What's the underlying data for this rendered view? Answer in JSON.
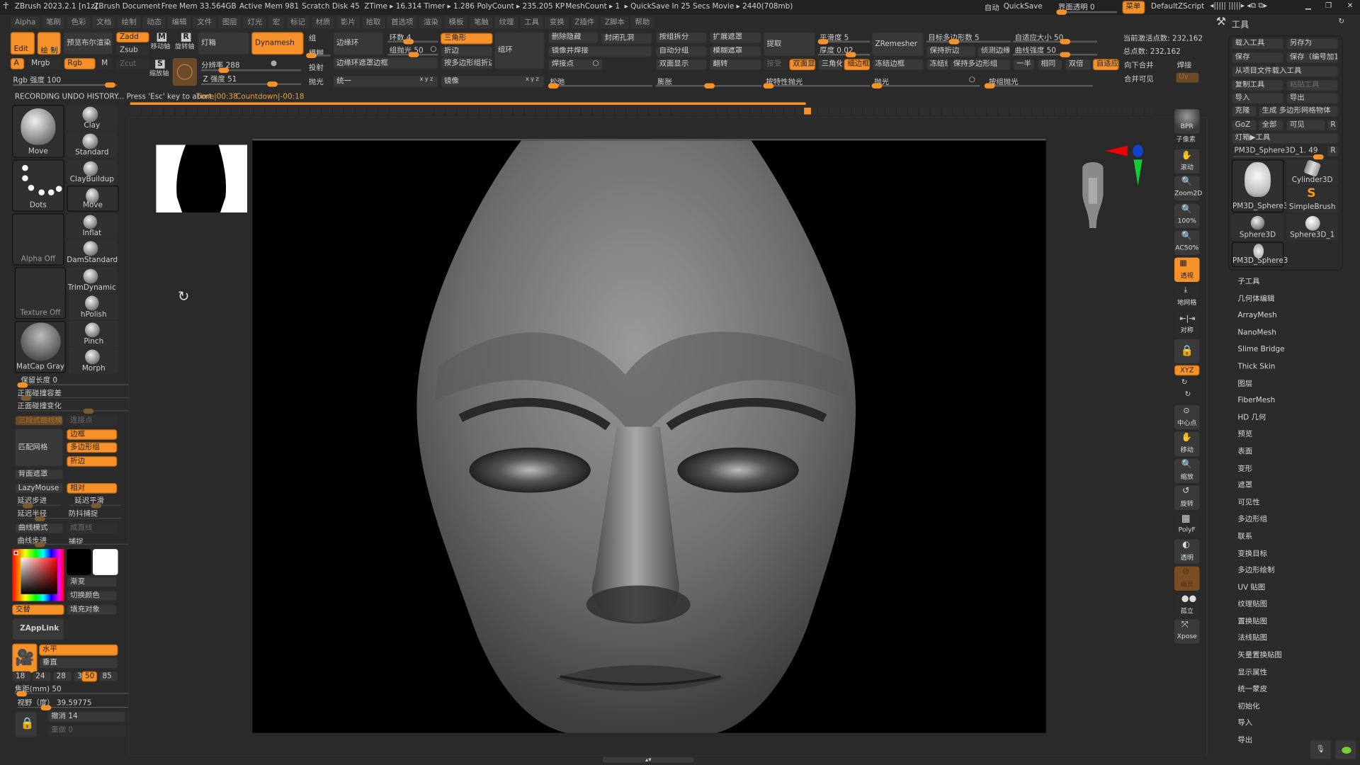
{
  "title_bar": {
    "app": "ZBrush 2023.2.1 [n1z]",
    "document": "ZBrush Document",
    "free_mem": "Free Mem 33.564GB",
    "active_mem": "Active Mem 981",
    "scratch_disk": "Scratch Disk 45",
    "ztime": "ZTime ▸ 16.314 Timer ▸ 1.286",
    "polycount": "PolyCount ▸ 235.205 KP",
    "meshcount": "MeshCount ▸ 1",
    "quicksave_info": "▸ QuickSave In 25 Secs Movie ▸ 2440(708mb)",
    "auto": "自动",
    "quicksave": "QuickSave",
    "ui_transparency": "界面透明 0",
    "menu": "菜单",
    "script": "DefaultZScript"
  },
  "menu_bar": [
    "Alpha",
    "笔刷",
    "色彩",
    "文档",
    "绘制",
    "动态",
    "编辑",
    "文件",
    "图层",
    "灯光",
    "宏",
    "标记",
    "材质",
    "影片",
    "拾取",
    "首选项",
    "渲染",
    "模板",
    "笔触",
    "纹理",
    "工具",
    "变换",
    "Z插件",
    "Z脚本",
    "帮助"
  ],
  "toolbar": {
    "edit": "Edit",
    "draw": "绘 制",
    "preview_boolean": "预览布尔渲染",
    "a": "A",
    "mrgb": "Mrgb",
    "rgb": "Rgb",
    "m": "M",
    "rgb_intensity": "Rgb 强度 100",
    "zadd": "Zadd",
    "zsub": "Zsub",
    "zcut": "Zcut",
    "move_axis": "移动轴",
    "rotate_axis": "旋转轴",
    "scale_axis": "缩放轴",
    "lightbox": "灯箱",
    "dynamesh": "Dynamesh",
    "resolution": "分辨率 288",
    "z_intensity": "Z 强度 51",
    "group": "组",
    "blur": "模糊",
    "project": "投射",
    "polish": "抛光",
    "edge_loop": "边缘环",
    "loops": "环数 4",
    "group_polish": "组抛光 50",
    "triangle": "三角形",
    "crease": "折边",
    "group_loops": "组环",
    "edge_loop_mask": "边缘环遮罩边框",
    "crease_pg": "按多边形组折边",
    "unify": "统一",
    "mirror": "镜像",
    "del_hidden": "删除隐藏",
    "close_holes": "封闭孔洞",
    "mirror_weld": "镜像并焊接",
    "weld_points": "焊接点",
    "relax": "松弛",
    "split_groups": "按组拆分",
    "auto_groups": "自动分组",
    "double": "双面显示",
    "inflate": "膨胀",
    "grow_mask": "扩展遮罩",
    "blur_mask": "模糊遮罩",
    "flip": "翻转",
    "extract": "提取",
    "accept": "接受",
    "double_short": "双面显",
    "smooth": "平滑度 5",
    "thickness": "厚度 0.02",
    "triangulate": "三角化",
    "thin_border": "细边框",
    "polish_features": "按特性抛光",
    "zremesher": "ZRemesher",
    "freeze_border": "冻结边框",
    "target_poly": "目标多边形数 5",
    "keep_creases": "保持折边",
    "detect_edges": "侦测边缘",
    "freeze_groups": "冻结组",
    "keep_groups": "保持多边形组",
    "polish2": "抛光",
    "adaptive_size": "自适应大小 50",
    "curve_strength": "曲线强度 50",
    "half": "一半",
    "same": "相同",
    "dbl": "双倍",
    "adapt": "自适应",
    "polish_groups": "按组抛光",
    "active_points": "当前激活点数: 232,162",
    "total_points": "总点数: 232,162",
    "merge_down": "向下合并",
    "weld": "焊接",
    "merge_visible": "合并可见",
    "uv": "Uv",
    "xyz": "x y z"
  },
  "status": {
    "message": "RECORDING UNDO HISTORY... Press 'Esc' key to abort.",
    "time": "Time|00:38",
    "countdown": "Countdown|-00:18",
    "progress": 0.66
  },
  "left": {
    "brushes": {
      "current": "Move",
      "list": [
        "Clay",
        "Standard",
        "ClayBuildup",
        "Move",
        "Inflat",
        "DamStandard",
        "TrimDynamic",
        "hPolish",
        "Pinch",
        "Morph"
      ]
    },
    "stroke": "Dots",
    "alpha": "Alpha Off",
    "texture": "Texture Off",
    "material": "MatCap Gray",
    "keep_length": "保留长度 0",
    "front_collision_tol": "正面碰撞容差",
    "front_collision_var": "正面碰撞变化",
    "tri_curve": "三段式曲线模式",
    "connect": "连接点",
    "fit_mesh": "匹配网格",
    "border": "边框",
    "polygroups": "多边形组",
    "crease": "折边",
    "backface": "背面遮罩",
    "lazymouse": "LazyMouse",
    "relative": "相对",
    "lazy_step": "延迟步进",
    "lazy_smooth": "延迟平滑",
    "lazy_radius": "延迟半径",
    "anti_jitter": "防抖捕捉",
    "curve_mode": "曲线模式",
    "straight": "成直线",
    "curve_step": "曲线步进",
    "snap": "捕捉",
    "gradient": "渐变",
    "switch_color": "切换颜色",
    "alternate": "交替",
    "fill_object": "填充对象",
    "zapplink": "ZAppLink",
    "horizontal": "水平",
    "vertical": "垂直",
    "focal_presets": [
      "18",
      "24",
      "28",
      "35",
      "50",
      "85"
    ],
    "focal_selected": "50",
    "focal_length": "焦距(mm) 50",
    "fov": "视野（度） 39.59775",
    "undo": "撤消 14",
    "redo": "重做 0",
    "main_color": "#000000",
    "secondary_color": "#ffffff"
  },
  "shelf": [
    "BPR",
    "子像素",
    "滚动",
    "Zoom2D",
    "100%",
    "AC50%",
    "透视",
    "地网格",
    "对称",
    "XYZ",
    "中心点",
    "移动",
    "缩放",
    "旋转",
    "PolyF",
    "透明",
    "幽灵",
    "孤立",
    "Xpose"
  ],
  "right": {
    "title": "工具",
    "load": "载入工具",
    "save_as": "另存为",
    "save": "保存",
    "save_inc": "保存（编号加1",
    "load_project": "从项目文件载入工具",
    "copy": "复制工具",
    "paste": "粘贴工具",
    "import": "导入",
    "export": "导出",
    "clone": "克隆",
    "make_polymesh": "生成 多边形网格物体",
    "goz": "GoZ",
    "all": "全部",
    "visible": "可见",
    "r": "R",
    "lightbox_tool": "灯箱▶工具",
    "current_tool": "PM3D_Sphere3D_1. 49",
    "tools": [
      "PM3D_Sphere3",
      "Cylinder3D",
      "SimpleBrush",
      "Sphere3D",
      "Sphere3D_1",
      "PM3D_Sphere3"
    ],
    "menu": [
      "子工具",
      "几何体编辑",
      "ArrayMesh",
      "NanoMesh",
      "Slime Bridge",
      "Thick Skin",
      "图层",
      "FiberMesh",
      "HD 几何",
      "预览",
      "表面",
      "变形",
      "遮罩",
      "可见性",
      "多边形组",
      "联系",
      "变换目标",
      "多边形绘制",
      "UV 贴图",
      "纹理贴图",
      "置换贴图",
      "法线贴图",
      "矢量置换贴图",
      "显示属性",
      "统一蒙皮",
      "初始化",
      "导入",
      "导出"
    ]
  },
  "colors": {
    "accent": "#f7922a",
    "background": "#2b2b2b",
    "button": "#393939"
  }
}
